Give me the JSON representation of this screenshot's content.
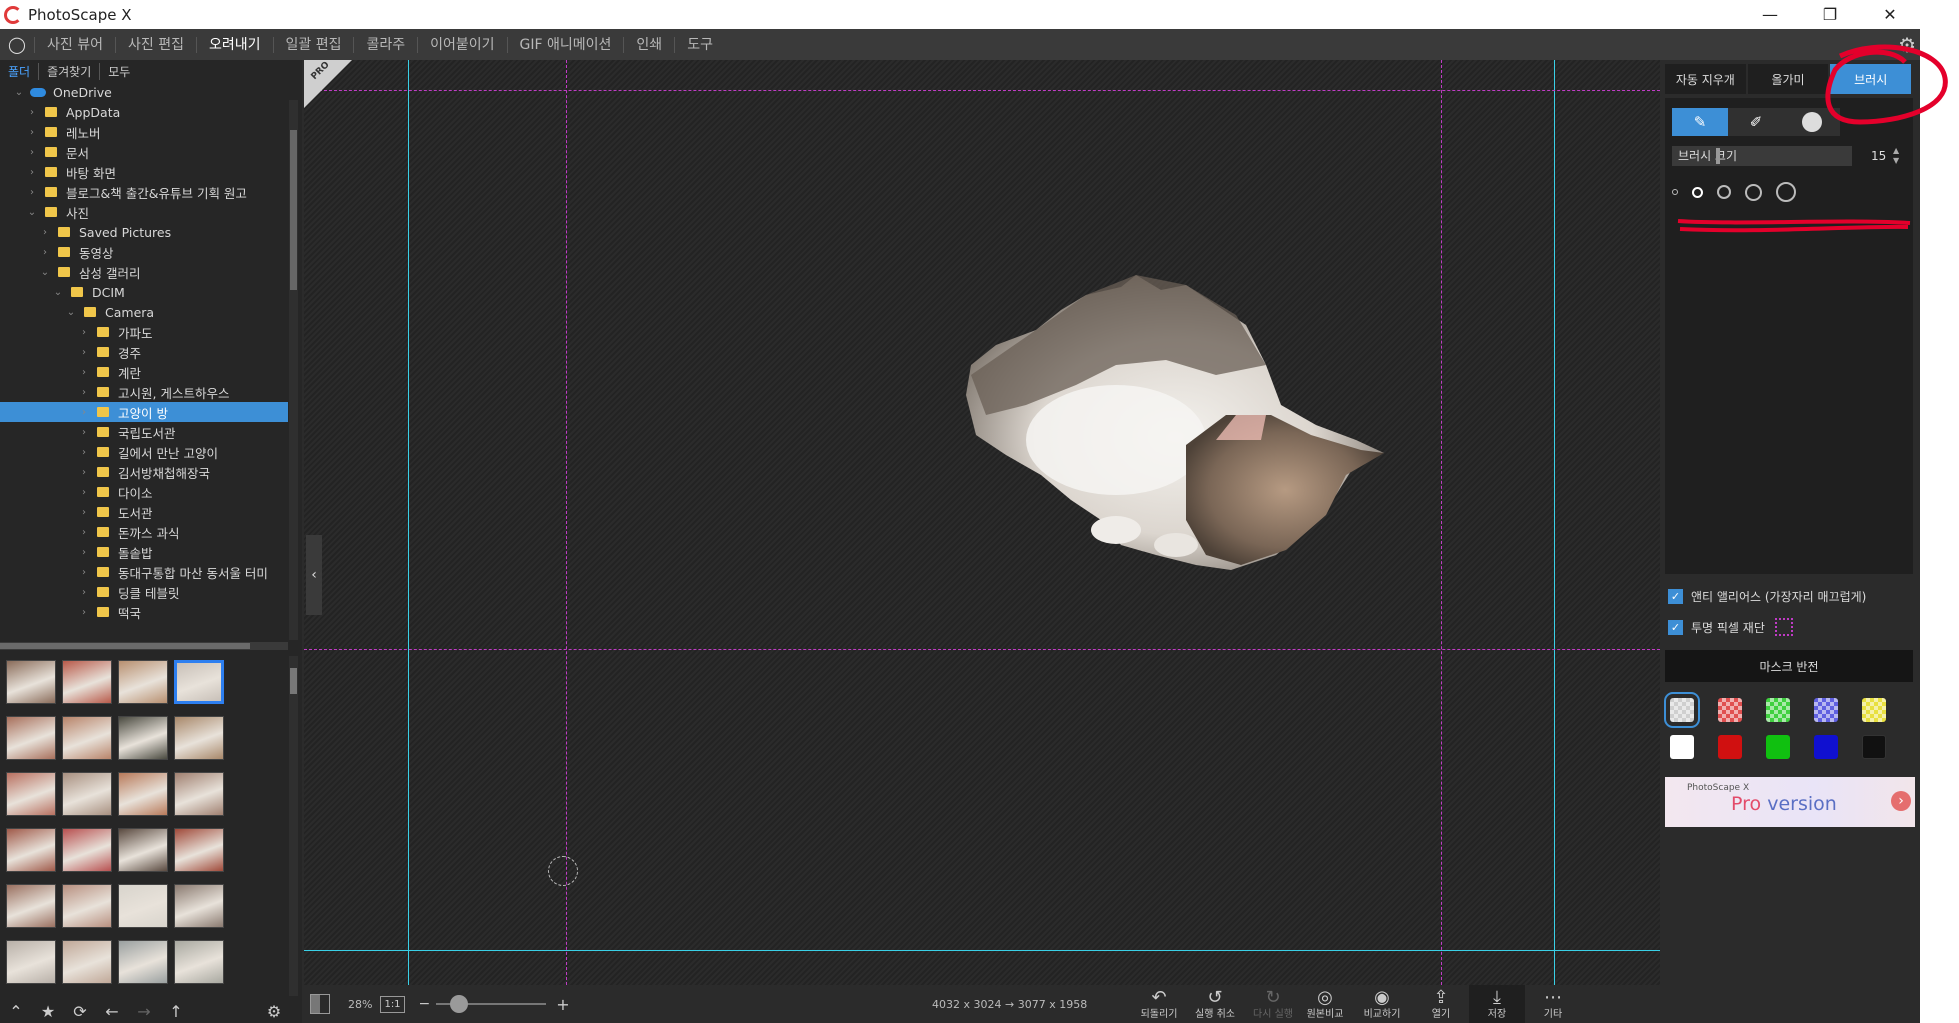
{
  "window": {
    "title": "PhotoScape X",
    "minimize": "—",
    "restore": "❐",
    "close": "✕"
  },
  "menu": {
    "tabs": [
      "사진 뷰어",
      "사진 편집",
      "오려내기",
      "일괄 편집",
      "콜라주",
      "이어붙이기",
      "GIF 애니메이션",
      "인쇄",
      "도구"
    ],
    "active_index": 2
  },
  "left_panel": {
    "subtabs": [
      "폴더",
      "즐겨찾기",
      "모두"
    ],
    "tree": [
      {
        "label": "OneDrive",
        "depth": 1,
        "expanded": true,
        "type": "cloud"
      },
      {
        "label": "AppData",
        "depth": 2,
        "expanded": false,
        "type": "folder"
      },
      {
        "label": "레노버",
        "depth": 2,
        "expanded": false,
        "type": "folder"
      },
      {
        "label": "문서",
        "depth": 2,
        "expanded": false,
        "type": "folder"
      },
      {
        "label": "바탕 화면",
        "depth": 2,
        "expanded": false,
        "type": "folder"
      },
      {
        "label": "블로그&책 출간&유튜브 기획 원고",
        "depth": 2,
        "expanded": false,
        "type": "folder"
      },
      {
        "label": "사진",
        "depth": 2,
        "expanded": true,
        "type": "folder"
      },
      {
        "label": "Saved Pictures",
        "depth": 3,
        "expanded": false,
        "type": "folder"
      },
      {
        "label": "동영상",
        "depth": 3,
        "expanded": false,
        "type": "folder"
      },
      {
        "label": "삼성 갤러리",
        "depth": 3,
        "expanded": true,
        "type": "folder"
      },
      {
        "label": "DCIM",
        "depth": 4,
        "expanded": true,
        "type": "folder"
      },
      {
        "label": "Camera",
        "depth": 5,
        "expanded": true,
        "type": "folder"
      },
      {
        "label": "가파도",
        "depth": 6,
        "expanded": false,
        "type": "folder"
      },
      {
        "label": "경주",
        "depth": 6,
        "expanded": false,
        "type": "folder"
      },
      {
        "label": "계란",
        "depth": 6,
        "expanded": false,
        "type": "folder"
      },
      {
        "label": "고시원, 게스트하우스",
        "depth": 6,
        "expanded": false,
        "type": "folder"
      },
      {
        "label": "고양이 방",
        "depth": 6,
        "expanded": false,
        "type": "folder",
        "selected": true
      },
      {
        "label": "국립도서관",
        "depth": 6,
        "expanded": false,
        "type": "folder"
      },
      {
        "label": "길에서 만난 고양이",
        "depth": 6,
        "expanded": false,
        "type": "folder"
      },
      {
        "label": "김서방채첩해장국",
        "depth": 6,
        "expanded": false,
        "type": "folder"
      },
      {
        "label": "다이소",
        "depth": 6,
        "expanded": false,
        "type": "folder"
      },
      {
        "label": "도서관",
        "depth": 6,
        "expanded": false,
        "type": "folder"
      },
      {
        "label": "돈까스 과식",
        "depth": 6,
        "expanded": false,
        "type": "folder"
      },
      {
        "label": "돌솥밥",
        "depth": 6,
        "expanded": false,
        "type": "folder"
      },
      {
        "label": "동대구통합 마산 동서울 터미",
        "depth": 6,
        "expanded": false,
        "type": "folder"
      },
      {
        "label": "딩클 테블릿",
        "depth": 6,
        "expanded": false,
        "type": "folder"
      },
      {
        "label": "떡국",
        "depth": 6,
        "expanded": false,
        "type": "folder"
      }
    ],
    "thumbnail_colors": [
      "#8a6c5a",
      "#b85a4a",
      "#b89070",
      "#c8c0b8",
      "#a8705c",
      "#b8846a",
      "#4a4a40",
      "#a8886a",
      "#b87060",
      "#a89080",
      "#b87a5a",
      "#a08070",
      "#a05a4a",
      "#b85050",
      "#5a4a40",
      "#a04a3a",
      "#9a7060",
      "#b89080",
      "#d8d4cc",
      "#8a7a70",
      "#b8b0a8",
      "#c0a898",
      "#9aa0a0",
      "#a8a8a0"
    ],
    "selected_thumbnail": 3,
    "bottom_icons": [
      "collapse-up-icon",
      "star-icon",
      "refresh-icon",
      "back-icon",
      "forward-icon",
      "up-icon",
      "settings-icon"
    ]
  },
  "canvas": {
    "pro_badge": "PRO",
    "zoom": "28%",
    "one_to_one": "1:1",
    "dimensions": "4032 x 3024 → 3077 x 1958"
  },
  "actions": [
    {
      "label": "되돌리기",
      "icon": "↶",
      "enabled": true
    },
    {
      "label": "실행 취소",
      "icon": "↺",
      "enabled": true
    },
    {
      "label": "다시 실행",
      "icon": "↻",
      "enabled": false
    },
    {
      "label": "원본비교",
      "icon": "◎",
      "enabled": true
    },
    {
      "label": "비교하기",
      "icon": "◉",
      "enabled": true
    },
    {
      "label": "열기",
      "icon": "⇪",
      "enabled": true
    },
    {
      "label": "저장",
      "icon": "⤓",
      "enabled": true,
      "highlighted": true
    },
    {
      "label": "기타",
      "icon": "⋯",
      "enabled": true
    }
  ],
  "right_panel": {
    "tabs": [
      "자동 지우개",
      "올가미",
      "브러시"
    ],
    "active_tab": 2,
    "brush_size_label": "브러시 크기",
    "brush_size_value": "15",
    "options": [
      {
        "label": "앤티 앨리어스 (가장자리 매끄럽게)",
        "checked": true
      },
      {
        "label": "투명 픽셀 재단",
        "checked": true
      }
    ],
    "mask_invert_label": "마스크 반전",
    "mask_colors": [
      {
        "color": "#ffffff",
        "checker": true
      },
      {
        "color": "#e05050",
        "checker": true
      },
      {
        "color": "#40d040",
        "checker": true
      },
      {
        "color": "#6060e0",
        "checker": true
      },
      {
        "color": "#e8e040",
        "checker": true
      },
      {
        "color": "#ffffff",
        "checker": false
      },
      {
        "color": "#d01010",
        "checker": false
      },
      {
        "color": "#10c010",
        "checker": false
      },
      {
        "color": "#1010d0",
        "checker": false
      },
      {
        "color": "#111111",
        "checker": false
      }
    ],
    "selected_mask_color": 0,
    "banner": {
      "small": "PhotoScape X",
      "pro": "Pro",
      "version": "version"
    }
  },
  "colors": {
    "accent": "#3d8fd6",
    "guide_cyan": "#3ad0e6",
    "guide_magenta": "#c03cc6",
    "annotation_red": "#e4002b"
  }
}
